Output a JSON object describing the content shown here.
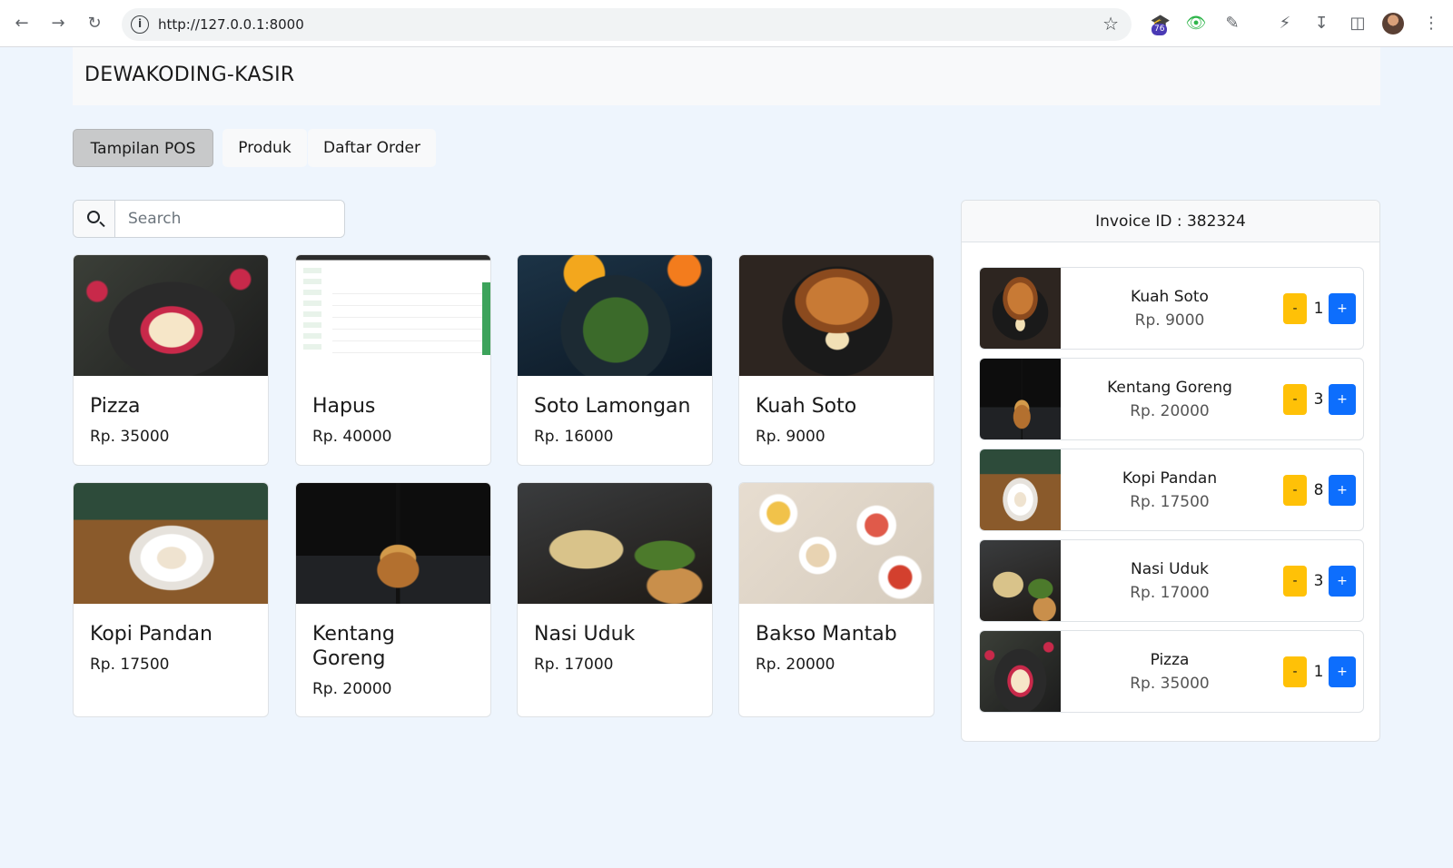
{
  "browser": {
    "url": "http://127.0.0.1:8000",
    "extension_badge": "76"
  },
  "brand": "DEWAKODING-KASIR",
  "tabs": [
    {
      "label": "Tampilan POS",
      "active": true
    },
    {
      "label": "Produk",
      "active": false
    },
    {
      "label": "Daftar Order",
      "active": false
    }
  ],
  "search": {
    "placeholder": "Search",
    "value": ""
  },
  "products": [
    {
      "name": "Pizza",
      "price": "Rp. 35000",
      "image": "cake-slice"
    },
    {
      "name": "Hapus",
      "price": "Rp. 40000",
      "image": "app-screenshot"
    },
    {
      "name": "Soto Lamongan",
      "price": "Rp. 16000",
      "image": "salad-bowl"
    },
    {
      "name": "Kuah Soto",
      "price": "Rp. 9000",
      "image": "french-toast"
    },
    {
      "name": "Kopi Pandan",
      "price": "Rp. 17500",
      "image": "coffee-cup"
    },
    {
      "name": "Kentang Goreng",
      "price": "Rp. 20000",
      "image": "burger"
    },
    {
      "name": "Nasi Uduk",
      "price": "Rp. 17000",
      "image": "grilled-plate"
    },
    {
      "name": "Bakso Mantab",
      "price": "Rp. 20000",
      "image": "table-spread"
    }
  ],
  "invoice": {
    "title": "Invoice ID : 382324",
    "items": [
      {
        "name": "Kuah Soto",
        "price": "Rp. 9000",
        "qty": "1",
        "minus_label": "-",
        "plus_label": "+"
      },
      {
        "name": "Kentang Goreng",
        "price": "Rp. 20000",
        "qty": "3",
        "minus_label": "-",
        "plus_label": "+"
      },
      {
        "name": "Kopi Pandan",
        "price": "Rp. 17500",
        "qty": "8",
        "minus_label": "-",
        "plus_label": "+"
      },
      {
        "name": "Nasi Uduk",
        "price": "Rp. 17000",
        "qty": "3",
        "minus_label": "-",
        "plus_label": "+"
      },
      {
        "name": "Pizza",
        "price": "Rp. 35000",
        "qty": "1",
        "minus_label": "-",
        "plus_label": "+"
      }
    ]
  },
  "colors": {
    "page_bg": "#eef5fd",
    "minus_button": "#ffc107",
    "plus_button": "#0d6efd",
    "active_tab": "#c8c9ca"
  }
}
